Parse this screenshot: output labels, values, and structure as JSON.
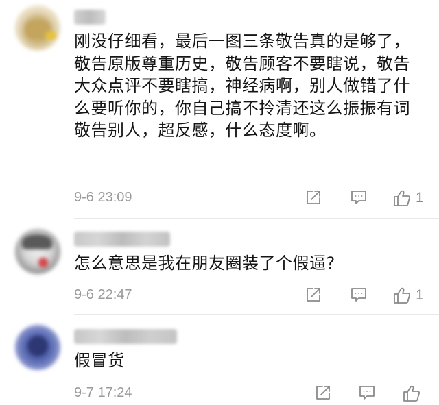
{
  "comments": [
    {
      "username": "",
      "content": "刚没仔细看，最后一图三条敬告真的是够了，敬告原版尊重历史，敬告顾客不要瞎说，敬告大众点评不要瞎搞，神经病啊，别人做错了什么要听你的，你自己搞不拎清还这么振振有词敬告别人，超反感，什么态度啊。",
      "time": "9-6 23:09",
      "likes": "1",
      "icons": [
        "share-icon",
        "comment-icon",
        "thumbs-up-icon"
      ]
    },
    {
      "username": "",
      "content": "怎么意思是我在朋友圈装了个假逼?",
      "time": "9-6 22:47",
      "likes": "1",
      "icons": [
        "share-icon",
        "comment-icon",
        "thumbs-up-icon"
      ]
    },
    {
      "username": "",
      "content": "假冒货",
      "time": "9-7 17:24",
      "likes": "",
      "icons": [
        "share-icon",
        "comment-icon",
        "thumbs-up-icon"
      ]
    }
  ],
  "colors": {
    "text": "#151515",
    "meta": "#9a9a9a",
    "icon": "#8a8a8a",
    "divider": "#e8e8e8"
  }
}
